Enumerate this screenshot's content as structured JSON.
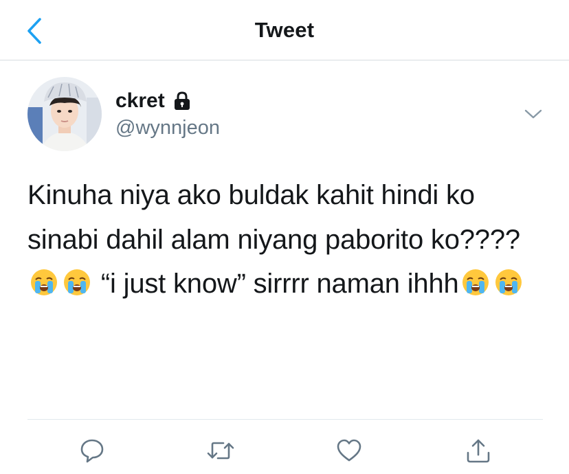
{
  "header": {
    "title": "Tweet"
  },
  "author": {
    "display_name": "ckret",
    "handle": "@wynnjeon",
    "protected_icon": "lock-icon"
  },
  "tweet": {
    "text_segments": [
      "Kinuha niya ako buldak kahit hindi ko sinabi dahil alam niyang paborito ko????",
      " “i just know” sirrrr naman ihhh"
    ],
    "emoji": "loudly-crying-face"
  },
  "actions": {
    "reply_icon": "reply-icon",
    "retweet_icon": "retweet-icon",
    "like_icon": "heart-icon",
    "share_icon": "share-icon"
  },
  "colors": {
    "accent": "#1da1f2",
    "text_primary": "#14171a",
    "text_secondary": "#657786",
    "divider": "#e1e8ed"
  }
}
